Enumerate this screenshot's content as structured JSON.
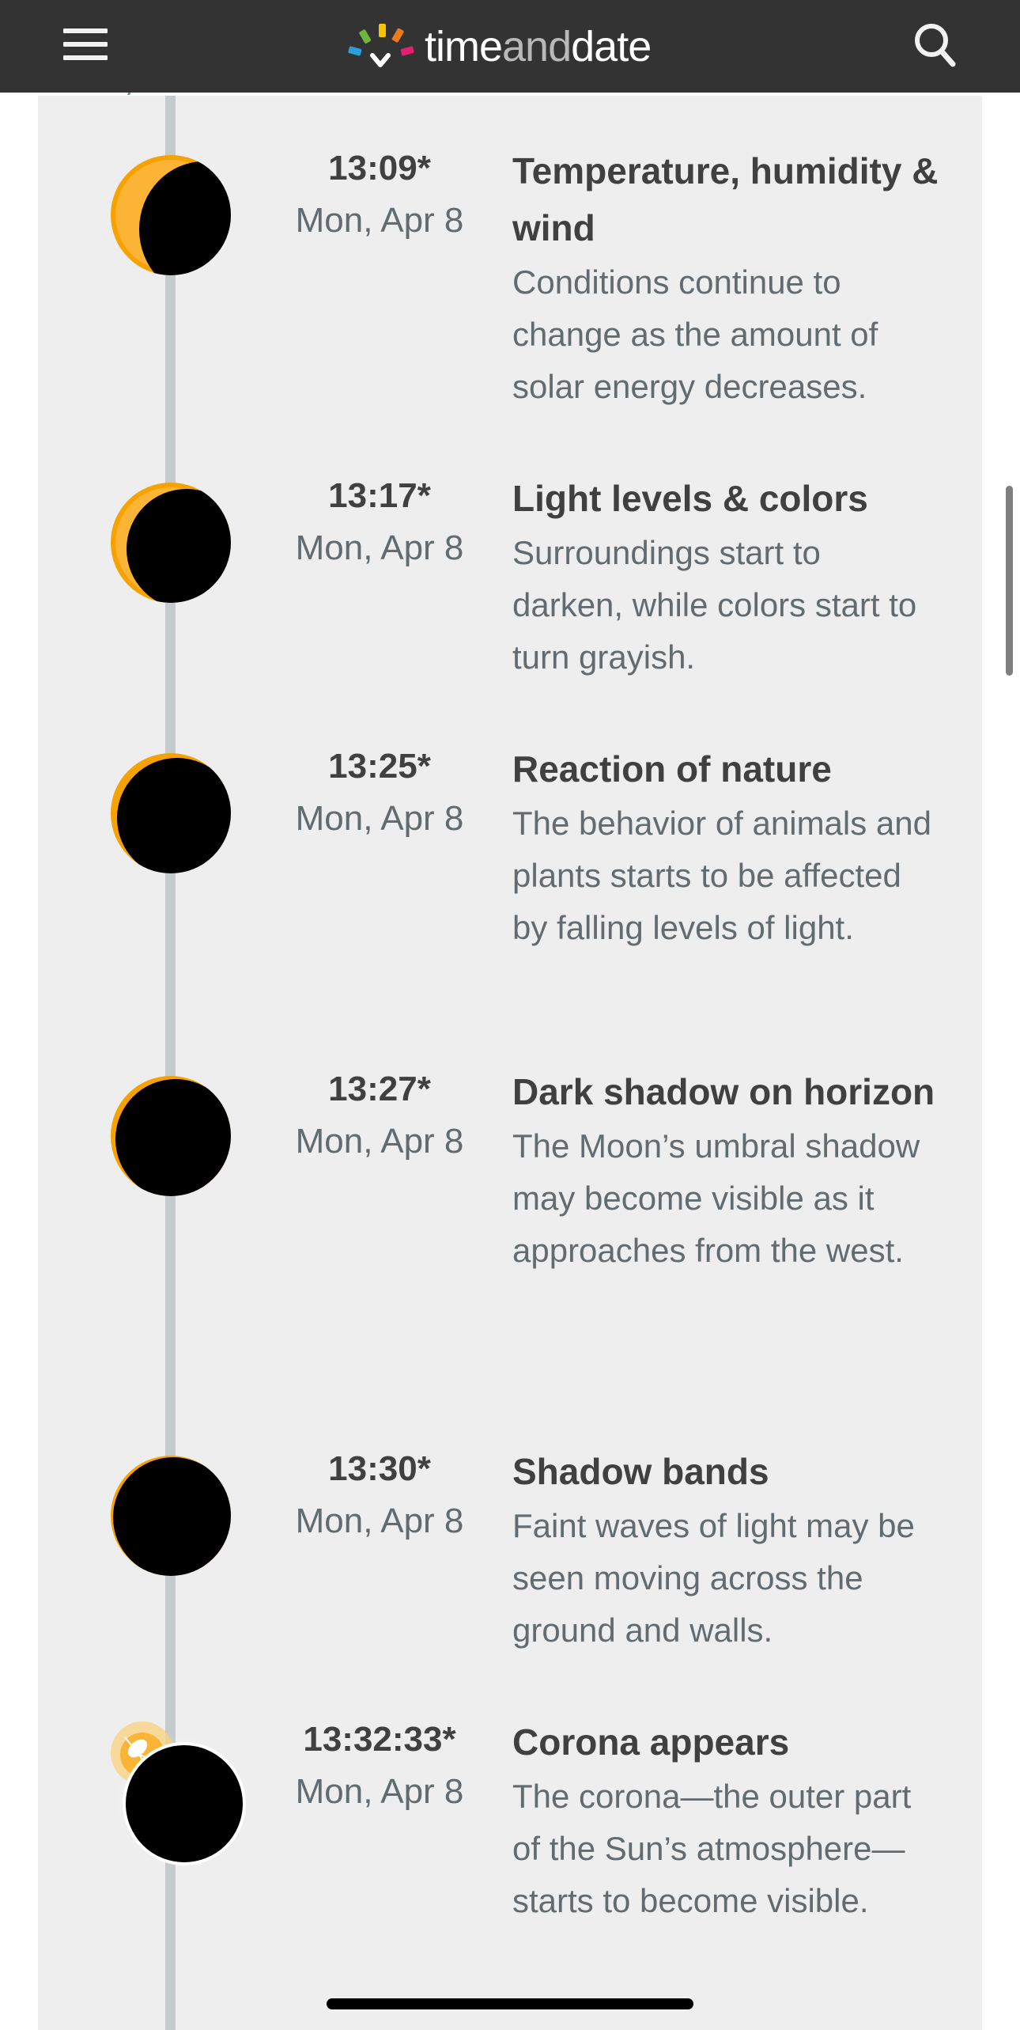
{
  "header": {
    "menu_icon": "hamburger-menu-icon",
    "logo": {
      "part1": "time",
      "part2": "and",
      "part3": "date"
    },
    "search_icon": "search-icon"
  },
  "colors": {
    "header_bg": "#333333",
    "card_bg": "#eeeeee",
    "timeline": "#c5cacd",
    "sun": "#fbb435",
    "sun_rim": "#f6a200",
    "moon": "#000000",
    "title": "#404040",
    "text": "#626b70"
  },
  "events": [
    {
      "time": "13:09*",
      "date": "Mon, Apr 8",
      "title": "Temperature, humidity & wind",
      "description": "Conditions continue to change as the amount of solar energy decreases.",
      "icon": "partial-eclipse-icon",
      "coverage": 0.55
    },
    {
      "time": "13:17*",
      "date": "Mon, Apr 8",
      "title": "Light levels & colors",
      "description": "Surroundings start to darken, while colors start to turn grayish.",
      "icon": "partial-eclipse-icon",
      "coverage": 0.72
    },
    {
      "time": "13:25*",
      "date": "Mon, Apr 8",
      "title": "Reaction of nature",
      "description": "The behavior of animals and plants starts to be affected by falling levels of light.",
      "icon": "partial-eclipse-icon",
      "coverage": 0.9
    },
    {
      "time": "13:27*",
      "date": "Mon, Apr 8",
      "title": "Dark shadow on horizon",
      "description": "The Moon’s umbral shadow may become visible as it approaches from the west.",
      "icon": "partial-eclipse-icon",
      "coverage": 0.93
    },
    {
      "time": "13:30*",
      "date": "Mon, Apr 8",
      "title": "Shadow bands",
      "description": "Faint waves of light may be seen moving across the ground and walls.",
      "icon": "partial-eclipse-icon",
      "coverage": 0.98
    },
    {
      "time": "13:32:33*",
      "date": "Mon, Apr 8",
      "title": "Corona appears",
      "description": "The corona—the outer part of the Sun’s atmosphere—starts to become visible.",
      "icon": "diamond-ring-eclipse-icon",
      "coverage": 1.0
    }
  ]
}
